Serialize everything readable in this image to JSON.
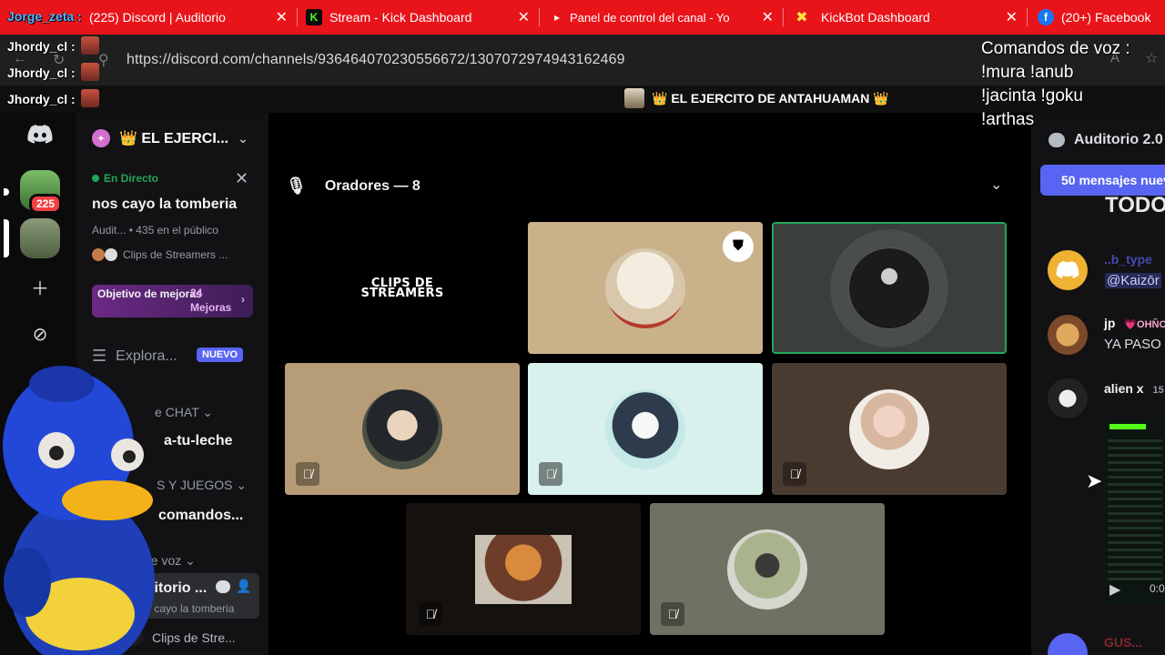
{
  "browser": {
    "tabs": [
      {
        "title": "(225) Discord | Auditorio",
        "favicon": "discord-icon"
      },
      {
        "title": "Stream - Kick Dashboard",
        "favicon": "kick-icon"
      },
      {
        "title": "Panel de control del canal - Yo",
        "favicon": "youtube-icon"
      },
      {
        "title": "KickBot Dashboard",
        "favicon": "kickbot-icon"
      },
      {
        "title": "(20+) Facebook",
        "favicon": "facebook-icon"
      }
    ],
    "address": "https://discord.com/channels/936464070230556672/1307072974943162469"
  },
  "overlay": {
    "chat_lines": [
      {
        "user": "Jorge_zeta",
        "sep": ":"
      },
      {
        "user": "Jhordy_cl",
        "sep": ":"
      },
      {
        "user": "Jhordy_cl",
        "sep": ":"
      },
      {
        "user": "Jhordy_cl",
        "sep": ":"
      }
    ],
    "voice_commands": {
      "title": "Comandos de voz :",
      "lines": [
        "!mura !anub",
        "!jacinta !goku",
        "!arthas"
      ]
    }
  },
  "channel_banner": "👑 EL EJERCITO DE ANTAHUAMAN 👑",
  "server": {
    "name": "👑 EL EJERCI...",
    "unread_count": "225",
    "live": {
      "label": "En Directo",
      "title": "nos cayo la tomberia",
      "meta": "Audit... • 435 en el público",
      "clips": "Clips de Streamers ..."
    },
    "goal": {
      "left": "Objetivo de mejoras",
      "count": "24",
      "unit": "Mejoras"
    },
    "explore": "Explora...",
    "new_badge": "NUEVO",
    "items": {
      "chat_cat": "e CHAT",
      "channel1": "a-tu-leche",
      "games_cat": "S Y JUEGOS",
      "channel2": "comandos...",
      "voice_cat": "de voz",
      "voice_channel": "uditorio ...",
      "voice_sub": "s cayo la tomberia",
      "clips_user": "Clips de Stre..."
    }
  },
  "stage": {
    "header": "Oradores — 8",
    "clips_logo": [
      "CLIPS DE",
      "STREAMERS"
    ],
    "tiles": [
      {
        "bg": "#000000",
        "muted": false,
        "moderator": false,
        "logo": true
      },
      {
        "bg": "#c9b28a",
        "muted": false,
        "moderator": true,
        "face": "dog"
      },
      {
        "bg": "#3a3f3c",
        "muted": false,
        "moderator": false,
        "face": "suit",
        "speaking": true
      },
      {
        "bg": "#b69d78",
        "muted": true,
        "moderator": false,
        "face": "anime"
      },
      {
        "bg": "#d8f1ec",
        "muted": true,
        "moderator": false,
        "face": "penguin"
      },
      {
        "bg": "#4a3b30",
        "muted": true,
        "moderator": false,
        "face": "girl"
      },
      {
        "bg": "#15110e",
        "muted": true,
        "moderator": false,
        "face": "cat"
      },
      {
        "bg": "#6e7263",
        "muted": true,
        "moderator": false,
        "face": "person"
      }
    ]
  },
  "chat": {
    "title": "Auditorio 2.0",
    "new_messages": "50 mensajes nuev",
    "todo": "TODO",
    "messages": [
      {
        "name": "..b_type",
        "text": "@Kaizōr"
      },
      {
        "name": "jp",
        "tag": "💗OHÑO",
        "text": "YA PASO"
      },
      {
        "name": "alien x",
        "time": "15",
        "text": ""
      }
    ],
    "bottom_user": "GUS..."
  }
}
